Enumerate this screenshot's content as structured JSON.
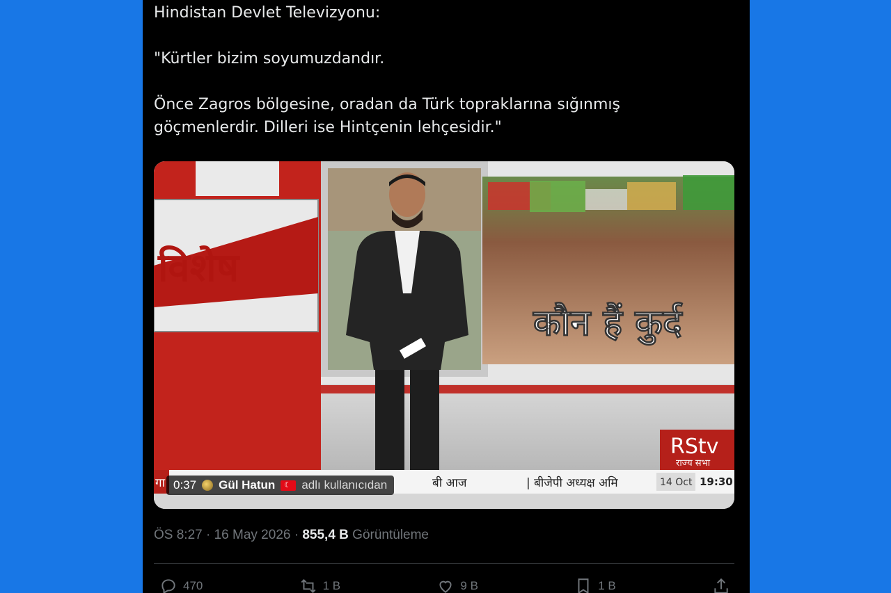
{
  "tweet": {
    "line1": "Hindistan Devlet Televizyonu:",
    "line2": "\"Kürtler bizim soyumuzdandır.",
    "line3": "Önce Zagros bölgesine, oradan da Türk topraklarına sığınmış",
    "line4": "göçmenlerdir. Dilleri ise Hintçenin lehçesidir.\""
  },
  "video": {
    "left_banner": "विशेष",
    "right_caption": "कौन हैं कुर्द",
    "ticker_left": "गा",
    "ticker_mid": "बी आज",
    "ticker_right": "| बीजेपी अध्यक्ष अमि",
    "ticker_date": "14 Oct",
    "ticker_time": "19:30",
    "channel_logo": "RStv",
    "channel_sub": "राज्य सभा",
    "overlay": {
      "time": "0:37",
      "user": "Gül Hatun",
      "suffix": "adlı kullanıcıdan"
    }
  },
  "meta": {
    "time_date": "ÖS 8:27 · 16 May 2026 · ",
    "views": "855,4 B",
    "views_label": " Görüntüleme"
  },
  "actions": {
    "replies": "470",
    "reposts": "1 B",
    "likes": "9 B",
    "bookmarks": "1 B"
  },
  "colors": {
    "background": "#1877e6",
    "card": "#000000",
    "text": "#e7e9ea",
    "muted": "#71767b"
  }
}
